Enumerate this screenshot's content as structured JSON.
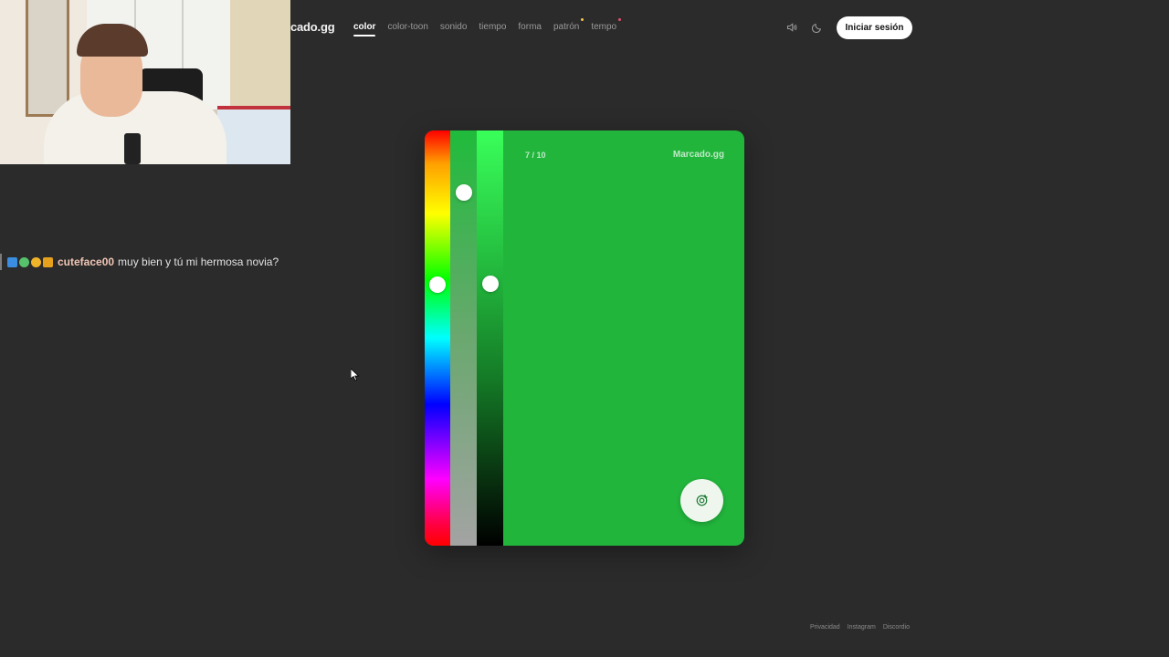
{
  "site": {
    "logo": "cado.gg"
  },
  "nav": {
    "tabs": [
      {
        "label": "color",
        "active": true
      },
      {
        "label": "color-toon"
      },
      {
        "label": "sonido"
      },
      {
        "label": "tiempo"
      },
      {
        "label": "forma"
      },
      {
        "label": "patrón",
        "dot": "#f2c94c"
      },
      {
        "label": "tempo",
        "dot": "#e8506a"
      }
    ]
  },
  "header": {
    "sound_icon": "speaker-icon",
    "theme_icon": "moon-icon",
    "login_label": "Iniciar sesión"
  },
  "chat": {
    "badges": [
      "prime-badge",
      "sparkle-badge",
      "one-badge",
      "crown-badge"
    ],
    "username": "cuteface00",
    "message": "muy bien y tú mi hermosa novia?"
  },
  "game": {
    "progress": "7 / 10",
    "brand": "Marcado.gg",
    "current_color": "#22b53c",
    "sliders": {
      "hue_position": 0.37,
      "saturation_position": 0.15,
      "lightness_position": 0.37
    },
    "submit_icon": "target-check-icon"
  },
  "footer": {
    "links": [
      "Privacidad",
      "Instagram",
      "Discordio"
    ]
  }
}
